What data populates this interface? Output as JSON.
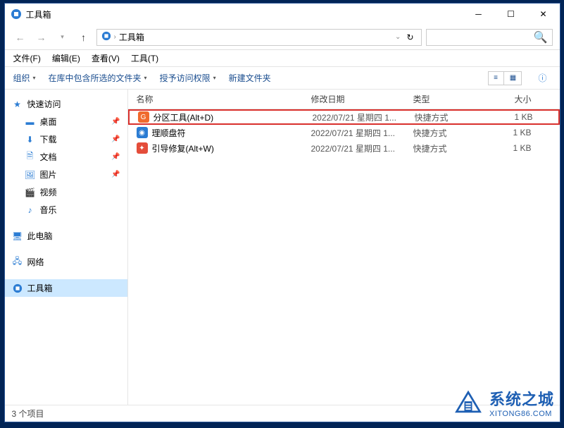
{
  "window": {
    "title": "工具箱"
  },
  "breadcrumb": {
    "root_icon": "toolbox",
    "items": [
      "工具箱"
    ]
  },
  "menubar": [
    {
      "label": "文件(F)"
    },
    {
      "label": "编辑(E)"
    },
    {
      "label": "查看(V)"
    },
    {
      "label": "工具(T)"
    }
  ],
  "toolbar": {
    "organize": "组织",
    "include": "在库中包含所选的文件夹",
    "grant": "授予访问权限",
    "newfolder": "新建文件夹"
  },
  "columns": {
    "name": "名称",
    "date": "修改日期",
    "type": "类型",
    "size": "大小"
  },
  "sidebar": {
    "quick": {
      "label": "快速访问",
      "items": [
        {
          "label": "桌面",
          "icon": "desktop",
          "pinned": true
        },
        {
          "label": "下载",
          "icon": "download",
          "pinned": true
        },
        {
          "label": "文档",
          "icon": "doc",
          "pinned": true
        },
        {
          "label": "图片",
          "icon": "pic",
          "pinned": true
        },
        {
          "label": "视频",
          "icon": "video",
          "pinned": false
        },
        {
          "label": "音乐",
          "icon": "music",
          "pinned": false
        }
      ]
    },
    "thispc": {
      "label": "此电脑"
    },
    "network": {
      "label": "网络"
    },
    "toolbox": {
      "label": "工具箱"
    }
  },
  "files": [
    {
      "name": "分区工具(Alt+D)",
      "date": "2022/07/21 星期四 1...",
      "type": "快捷方式",
      "size": "1 KB",
      "color": "#f06a2d",
      "highlight": true
    },
    {
      "name": "理顺盘符",
      "date": "2022/07/21 星期四 1...",
      "type": "快捷方式",
      "size": "1 KB",
      "color": "#2b7cd3",
      "highlight": false
    },
    {
      "name": "引导修复(Alt+W)",
      "date": "2022/07/21 星期四 1...",
      "type": "快捷方式",
      "size": "1 KB",
      "color": "#e44d3a",
      "highlight": false
    }
  ],
  "status": {
    "count": "3 个项目"
  },
  "watermark": {
    "cn": "系统之城",
    "en": "XITONG86.COM"
  }
}
